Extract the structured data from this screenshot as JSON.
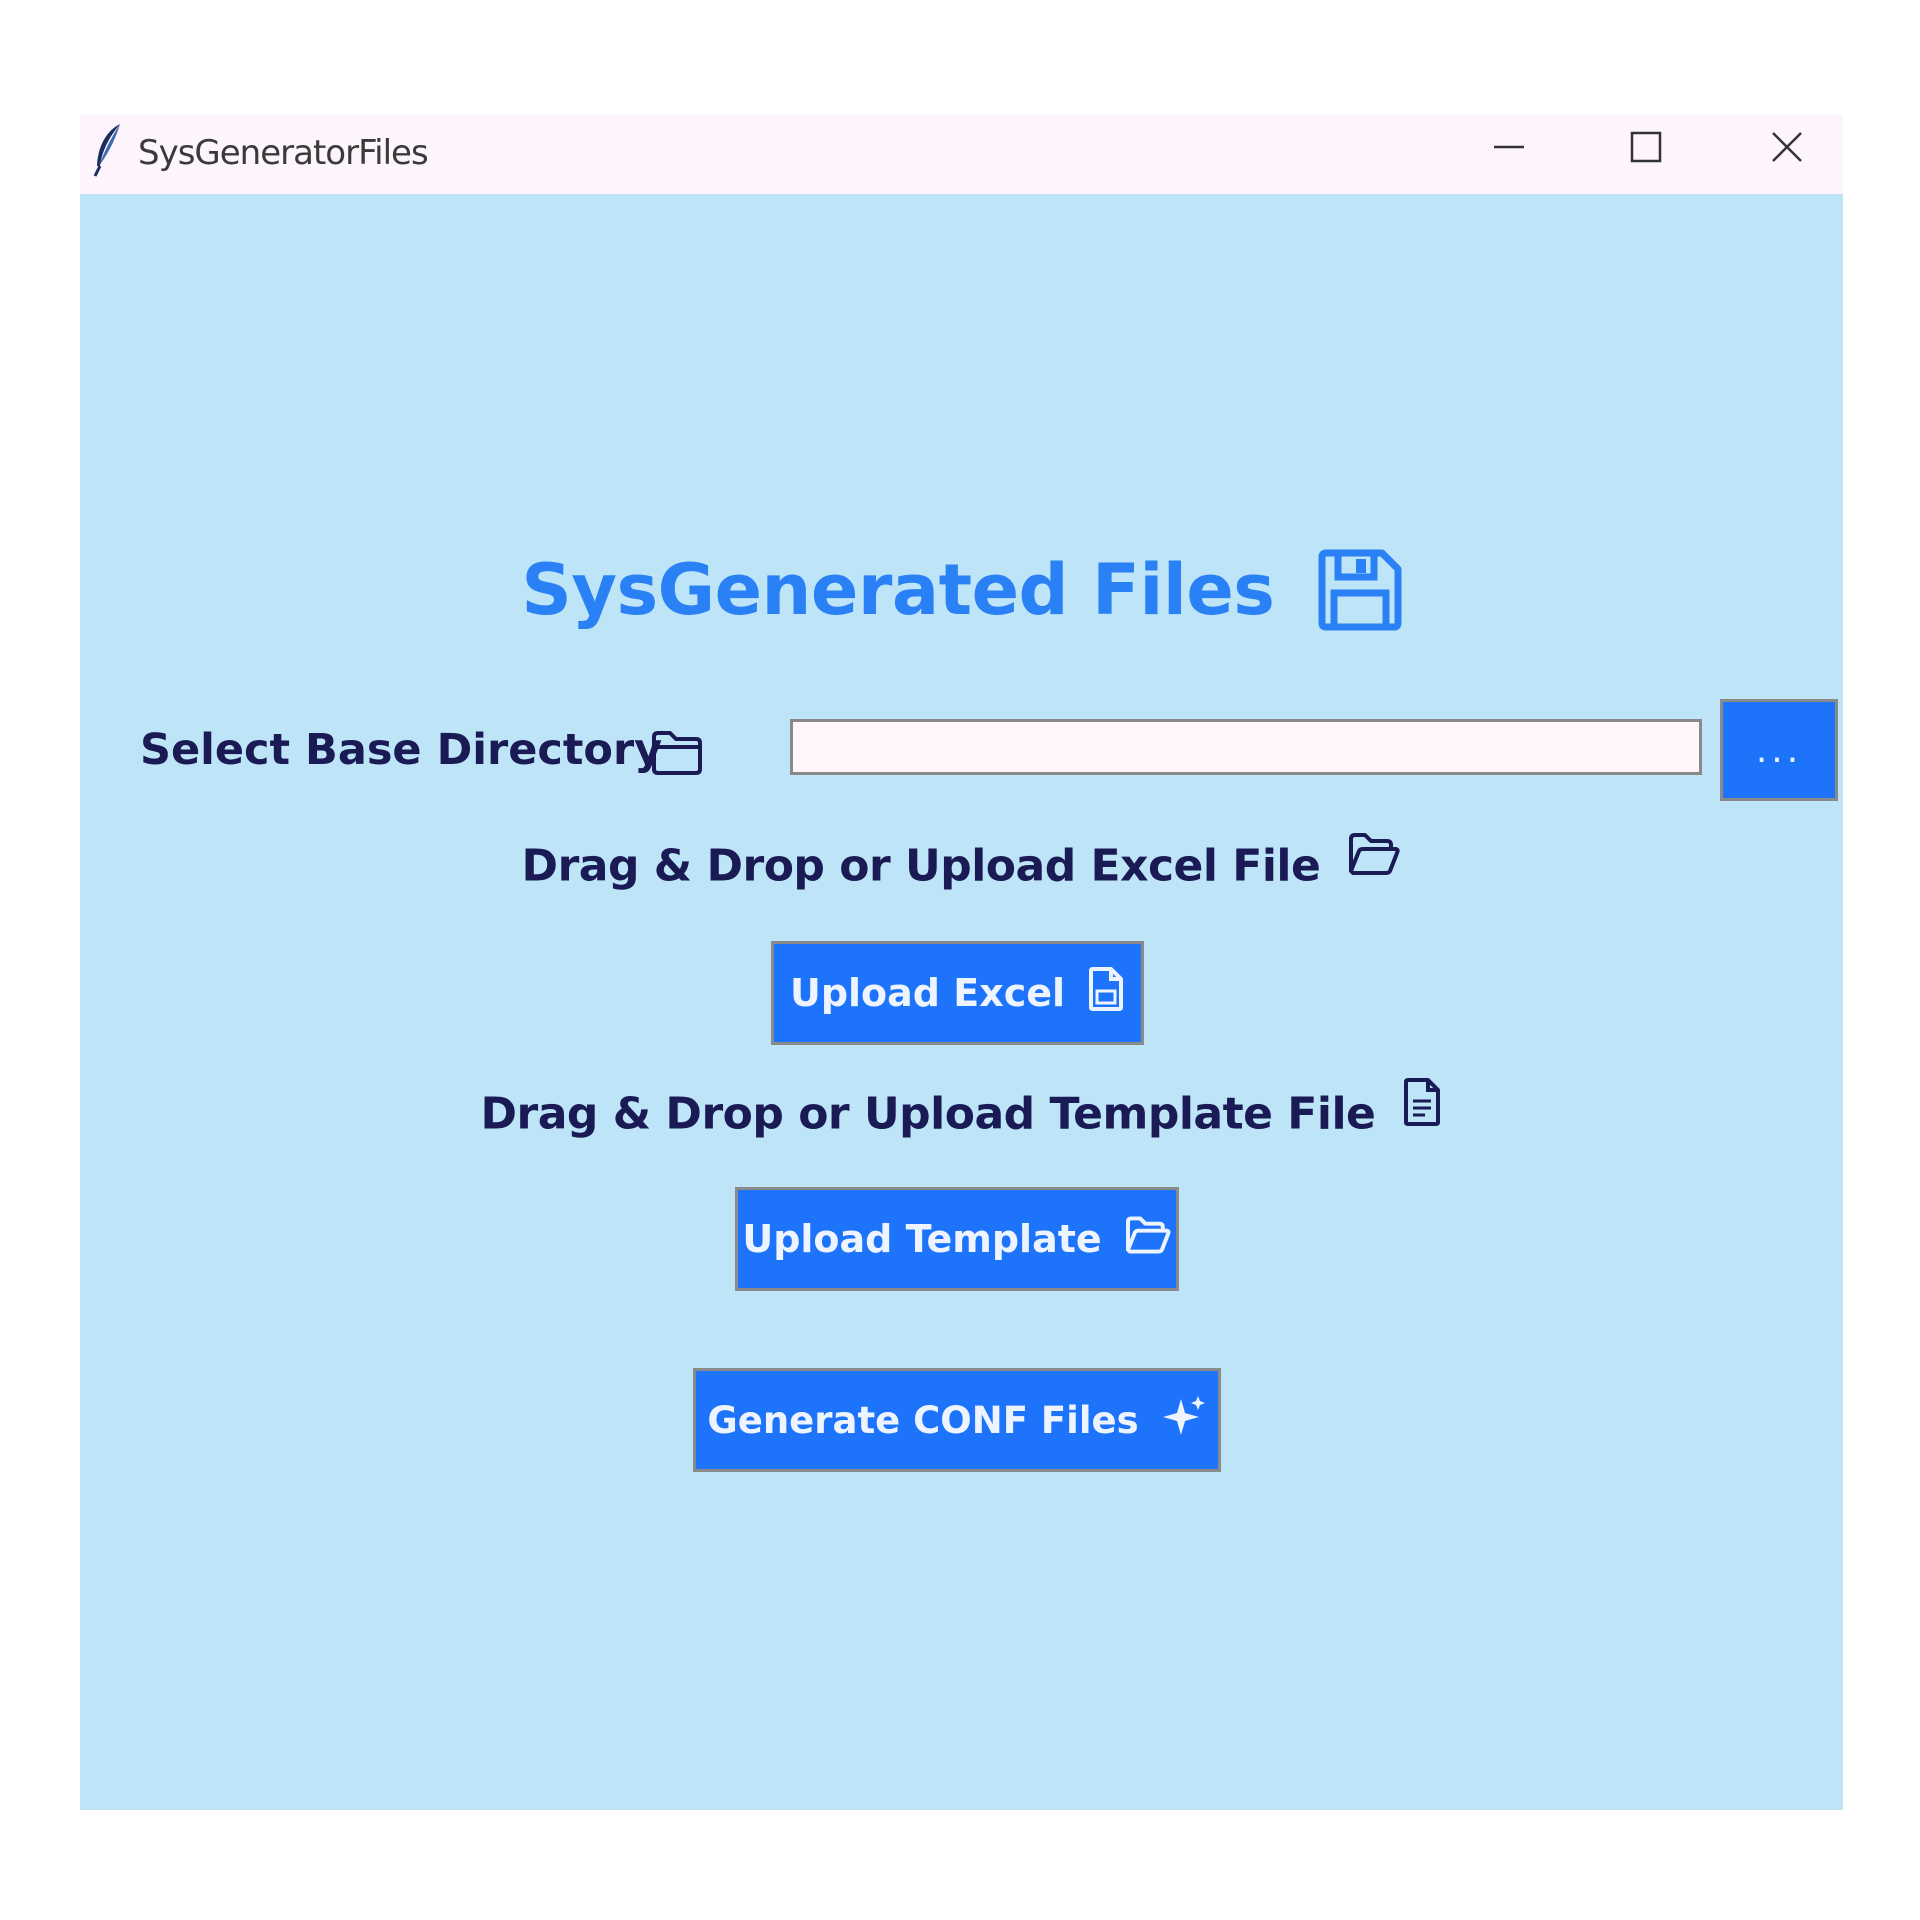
{
  "window": {
    "title": "SysGeneratorFiles",
    "icons": {
      "app": "feather-icon",
      "minimize": "minimize-icon",
      "maximize": "maximize-icon",
      "close": "close-icon"
    }
  },
  "app": {
    "title": "SysGenerated Files",
    "title_icon": "floppy-disk-icon"
  },
  "directory": {
    "label": "Select Base Directory",
    "label_icon": "folder-icon",
    "input_value": "",
    "input_placeholder": "",
    "browse_label": "..."
  },
  "excel": {
    "section_label": "Drag & Drop or Upload Excel File",
    "section_icon": "open-folder-icon",
    "button_label": "Upload Excel",
    "button_icon": "file-icon"
  },
  "template": {
    "section_label": "Drag & Drop or Upload Template File",
    "section_icon": "document-icon",
    "button_label": "Upload Template",
    "button_icon": "open-folder-icon"
  },
  "generate": {
    "button_label": "Generate CONF Files",
    "button_icon": "sparkles-icon"
  },
  "colors": {
    "window_background": "#bee5f7",
    "titlebar_background": "#fdf5fb",
    "button_blue": "#1d74fb",
    "title_blue": "#2a80f5",
    "label_navy": "#1a1a55",
    "input_background": "#fff5fb"
  }
}
